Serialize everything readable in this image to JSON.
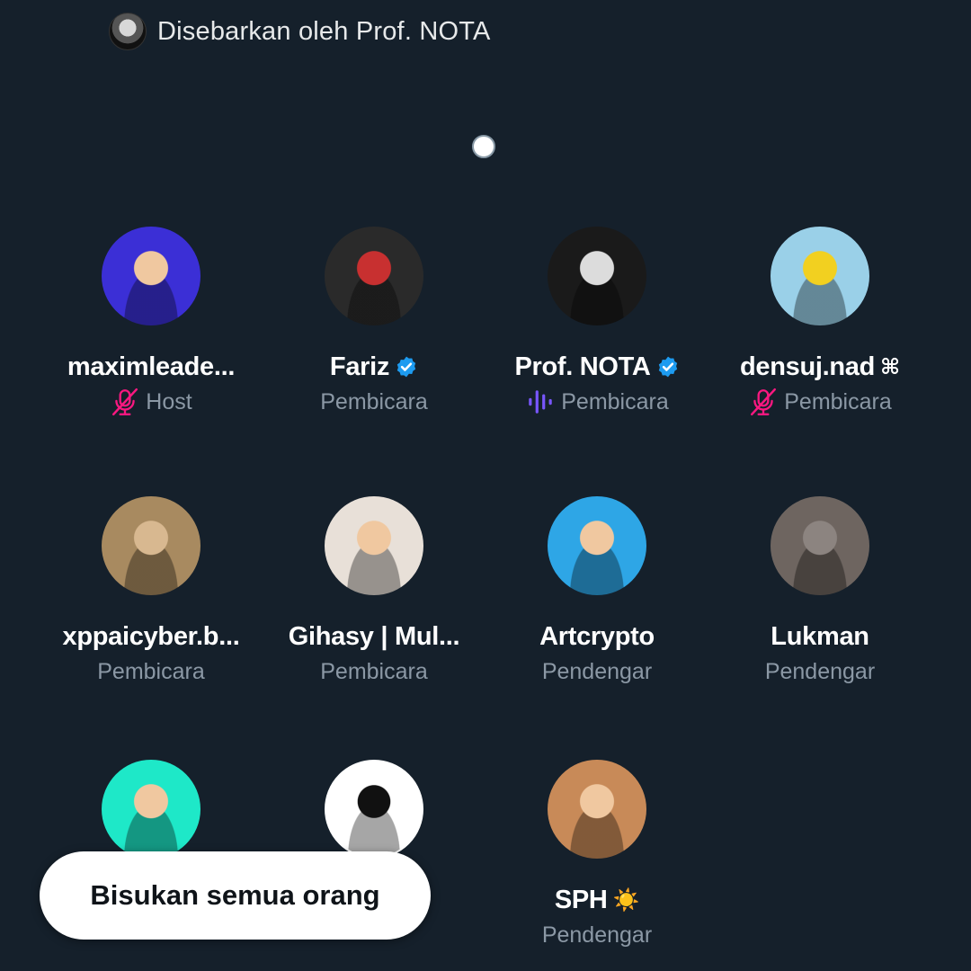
{
  "header": {
    "shared_by_text": "Disebarkan oleh Prof. NOTA",
    "shared_by_avatar_icon": "avatar-prof-nota"
  },
  "participants": [
    {
      "name": "maximleade...",
      "role": "Host",
      "verified": false,
      "suffix": "",
      "status_icon": "mic-muted-icon",
      "avatar_color": "#3b2fd6"
    },
    {
      "name": "Fariz",
      "role": "Pembicara",
      "verified": true,
      "suffix": "",
      "status_icon": "",
      "avatar_color": "#2a2a2a"
    },
    {
      "name": "Prof. NOTA",
      "role": "Pembicara",
      "verified": true,
      "suffix": "",
      "status_icon": "speaking-icon",
      "avatar_color": "#1a1a1a"
    },
    {
      "name": "densuj.nad",
      "role": "Pembicara",
      "verified": false,
      "suffix": "⌘",
      "status_icon": "mic-muted-icon",
      "avatar_color": "#9ad0e8"
    },
    {
      "name": "xppaicyber.b...",
      "role": "Pembicara",
      "verified": false,
      "suffix": "",
      "status_icon": "",
      "avatar_color": "#a88a60"
    },
    {
      "name": "Gihasy | Mul...",
      "role": "Pembicara",
      "verified": false,
      "suffix": "",
      "status_icon": "",
      "avatar_color": "#e8e0d8"
    },
    {
      "name": "Artcrypto",
      "role": "Pendengar",
      "verified": false,
      "suffix": "",
      "status_icon": "",
      "avatar_color": "#2ea6e6"
    },
    {
      "name": "Lukman",
      "role": "Pendengar",
      "verified": false,
      "suffix": "",
      "status_icon": "",
      "avatar_color": "#6e6560"
    },
    {
      "name": "",
      "role": "",
      "verified": false,
      "suffix": "",
      "status_icon": "",
      "avatar_color": "#1ee8c8"
    },
    {
      "name": "",
      "role": "",
      "verified": false,
      "suffix": "",
      "status_icon": "",
      "avatar_color": "#ffffff"
    },
    {
      "name": "SPH",
      "role": "Pendengar",
      "verified": false,
      "suffix": "☀️",
      "status_icon": "",
      "avatar_color": "#c88a58"
    }
  ],
  "colors": {
    "background": "#15202b",
    "muted_icon": "#f91880",
    "speaking_icon": "#7856ff",
    "verified_badge": "#1d9bf0",
    "role_text": "#8b98a5"
  },
  "mute_all_button": {
    "label": "Bisukan semua orang"
  }
}
